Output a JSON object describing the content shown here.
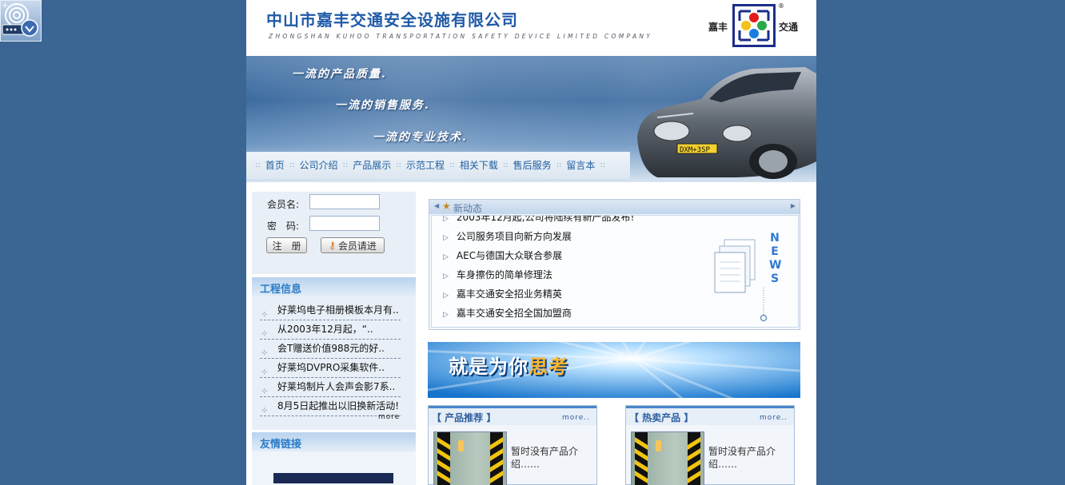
{
  "header": {
    "company_cn": "中山市嘉丰交通安全设施有限公司",
    "company_en": "ZHONGSHAN KUHOO TRANSPORTATION SAFETY DEVICE LIMITED COMPANY",
    "logo_left": "嘉丰",
    "logo_right": "交通",
    "logo_mark": "®"
  },
  "banner": {
    "slogan_1": "一流的产品质量.",
    "slogan_2": "一流的销售服务.",
    "slogan_3": "一流的专业技术.",
    "plate": "DXM+3SP"
  },
  "nav": {
    "items": [
      {
        "label": "首页"
      },
      {
        "label": "公司介绍"
      },
      {
        "label": "产品展示"
      },
      {
        "label": "示范工程"
      },
      {
        "label": "相关下载"
      },
      {
        "label": "售后服务"
      },
      {
        "label": "留言本"
      }
    ],
    "separator": "::"
  },
  "login": {
    "username_label": "会员名:",
    "password_label": "密　码:",
    "register_label": "注　册",
    "login_label": "会员请进"
  },
  "projects": {
    "title": "工程信息",
    "items": [
      {
        "label": "好莱坞电子相册模板本月有.."
      },
      {
        "label": "从2003年12月起，“.."
      },
      {
        "label": "会T赠送价值988元的好.."
      },
      {
        "label": "好莱坞DVPRO采集软件.."
      },
      {
        "label": "好莱坞制片人会声会影7系.."
      },
      {
        "label": "8月5日起推出以旧换新活动!"
      }
    ],
    "more": "more"
  },
  "friend_links": {
    "title": "友情链接"
  },
  "news": {
    "title": "新动态",
    "items": [
      {
        "label": "2003年12月起,公司将陆续有新产品发布!"
      },
      {
        "label": "公司服务项目向新方向发展"
      },
      {
        "label": "AEC与德国大众联合参展"
      },
      {
        "label": "车身擦伤的简单修理法"
      },
      {
        "label": "嘉丰交通安全招业务精英"
      },
      {
        "label": "嘉丰交通安全招全国加盟商"
      }
    ],
    "badge": "NEWS"
  },
  "promo": {
    "text_main": "就是为你",
    "text_highlight": "思考"
  },
  "products": {
    "recommended": {
      "title": "【 产品推荐 】",
      "more": "more..",
      "desc": "暂时没有产品介绍……"
    },
    "hot": {
      "title": "【 热卖产品 】",
      "more": "more..",
      "desc": "暂时没有产品介绍……"
    }
  },
  "colors": {
    "desktop_bg": "#3b6592",
    "accent": "#2a7cc8",
    "nav_text": "#2160a0"
  }
}
